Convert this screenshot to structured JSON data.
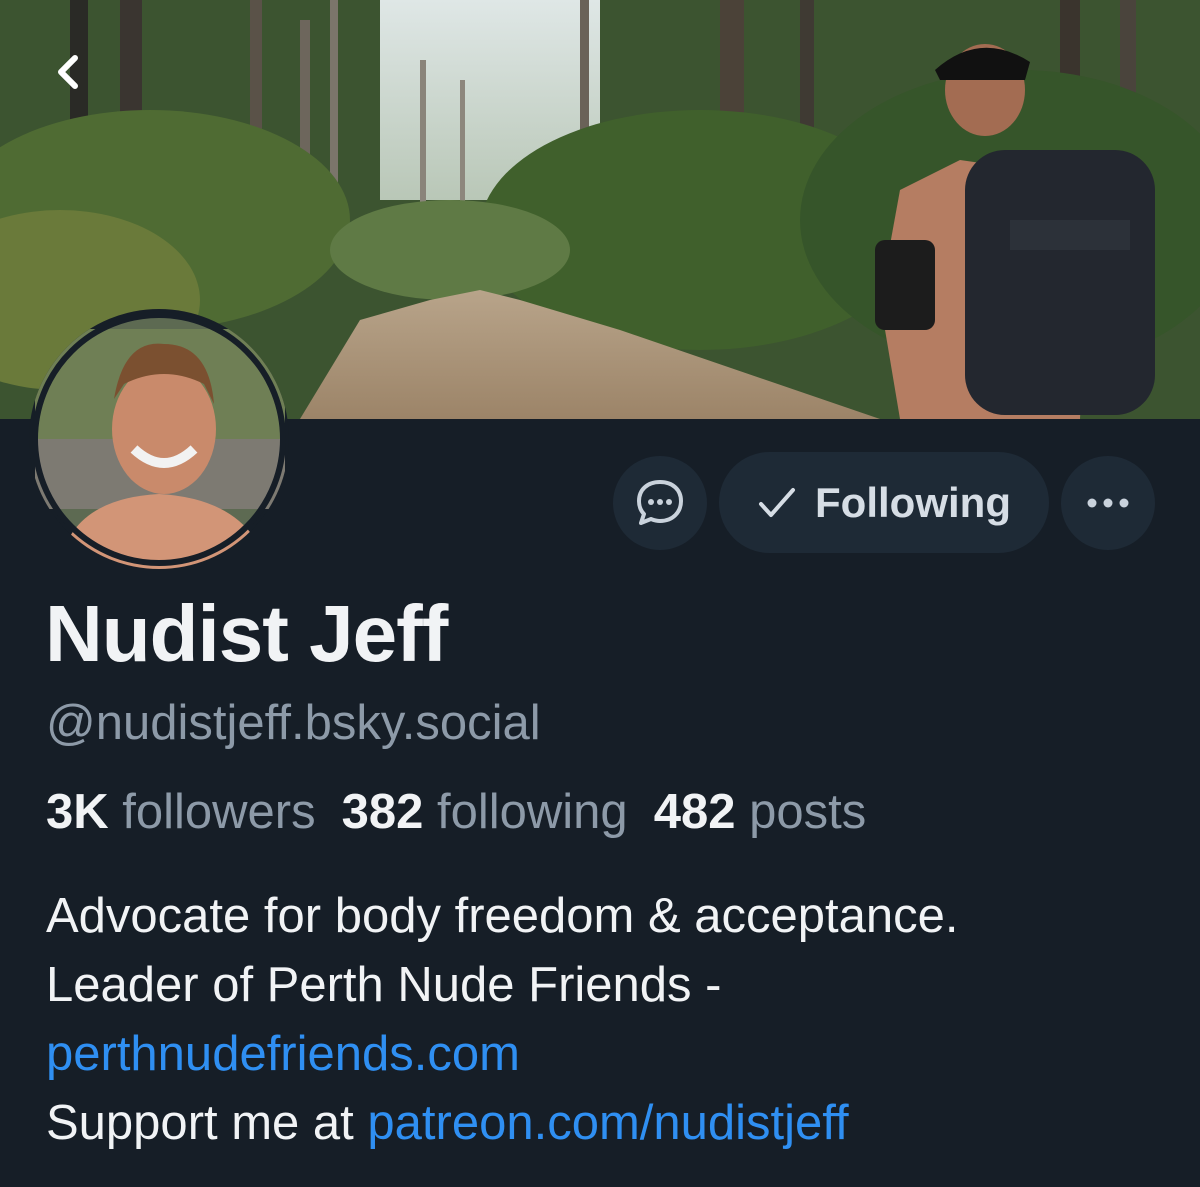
{
  "header": {
    "back_icon": "chevron-left-icon"
  },
  "actions": {
    "message_icon": "chat-bubble-icon",
    "follow_check_icon": "checkmark-icon",
    "follow_label": "Following",
    "more_icon": "ellipsis-icon"
  },
  "profile": {
    "display_name": "Nudist Jeff",
    "handle": "@nudistjeff.bsky.social",
    "stats": {
      "followers_count": "3K",
      "followers_label": "followers",
      "following_count": "382",
      "following_label": "following",
      "posts_count": "482",
      "posts_label": "posts"
    },
    "bio": {
      "line1": "Advocate for body freedom & acceptance.",
      "line2": "Leader of Perth Nude Friends -",
      "link1": "perthnudefriends.com",
      "line4_prefix": "Support me at",
      "link2": "patreon.com/nudistjeff"
    }
  },
  "colors": {
    "background": "#161e27",
    "button_bg": "#1e2a36",
    "muted_text": "#8d9aa8",
    "link": "#2f8ff2"
  }
}
